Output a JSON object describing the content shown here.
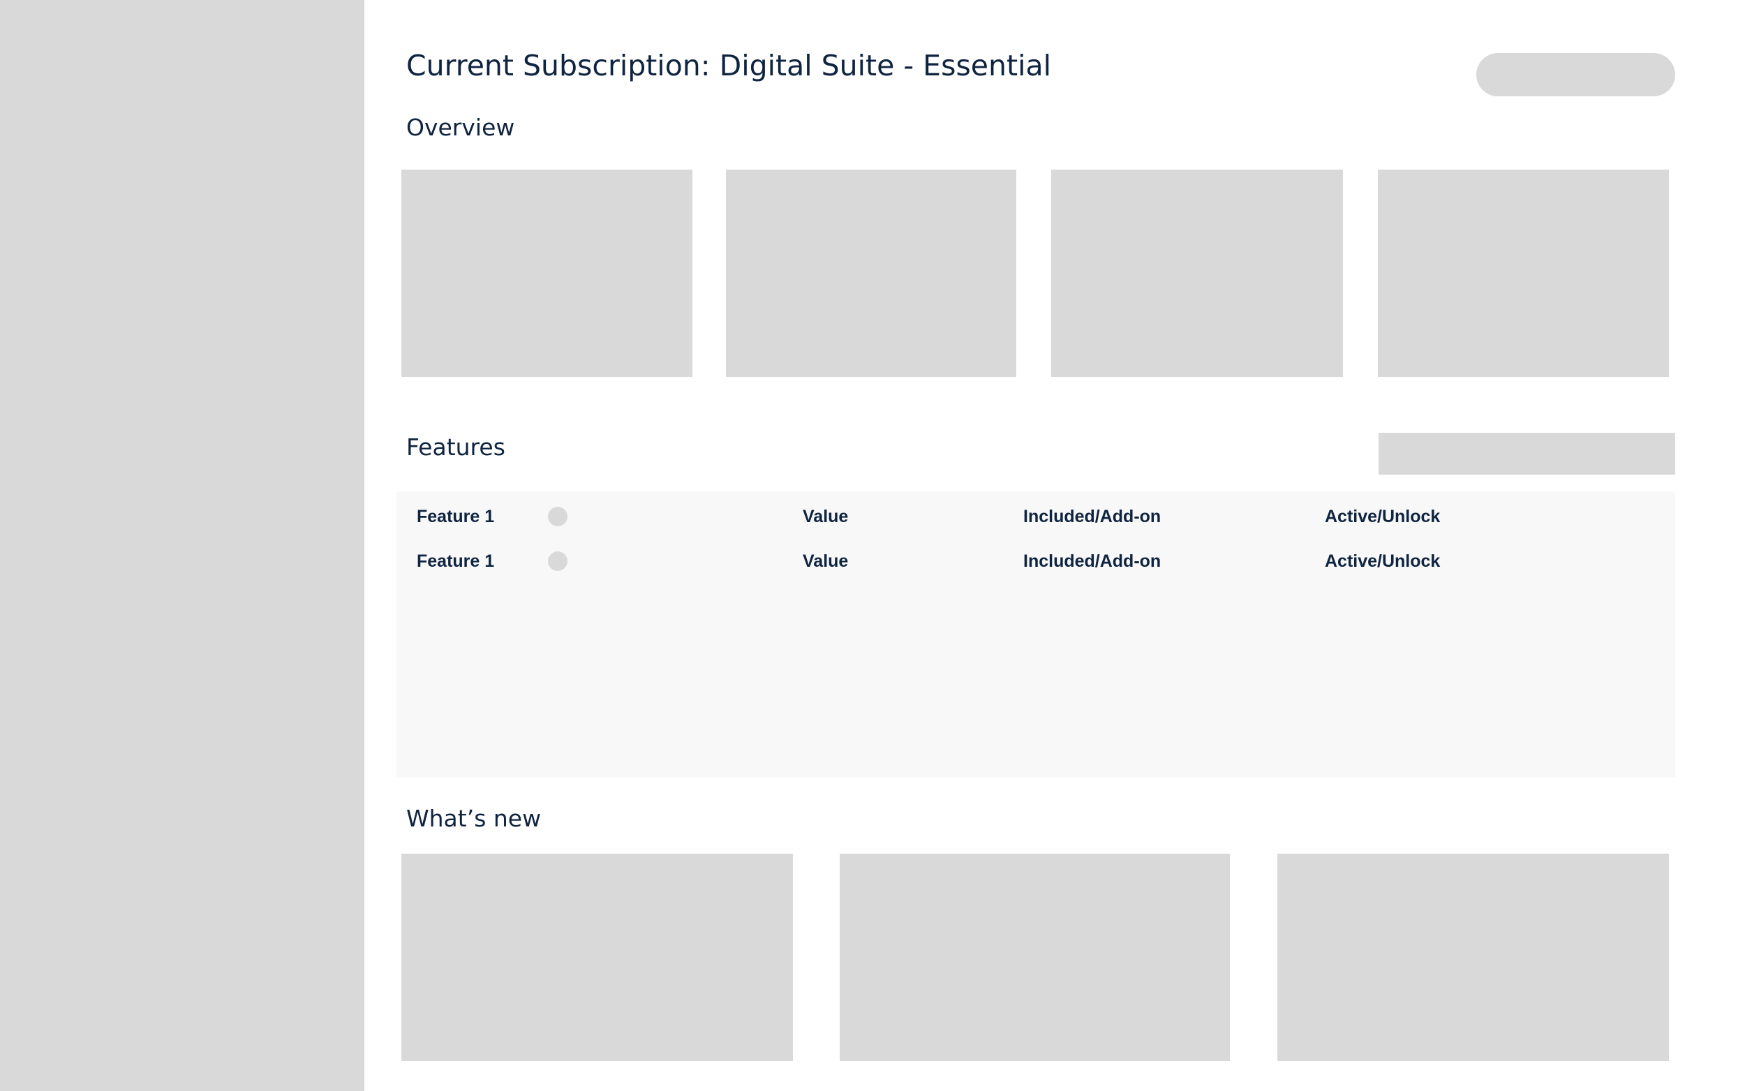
{
  "page": {
    "title": "Current Subscription: Digital Suite - Essential"
  },
  "overview": {
    "heading": "Overview"
  },
  "features": {
    "heading": "Features",
    "rows": [
      {
        "name": "Feature 1",
        "value": "Value",
        "type": "Included/Add-on",
        "action": "Active/Unlock"
      },
      {
        "name": "Feature 1",
        "value": "Value",
        "type": "Included/Add-on",
        "action": "Active/Unlock"
      }
    ]
  },
  "whats_new": {
    "heading": "What’s new"
  },
  "colors": {
    "text": "#0f2440",
    "placeholder": "#d9d9d9",
    "panel": "#f8f8f8"
  }
}
